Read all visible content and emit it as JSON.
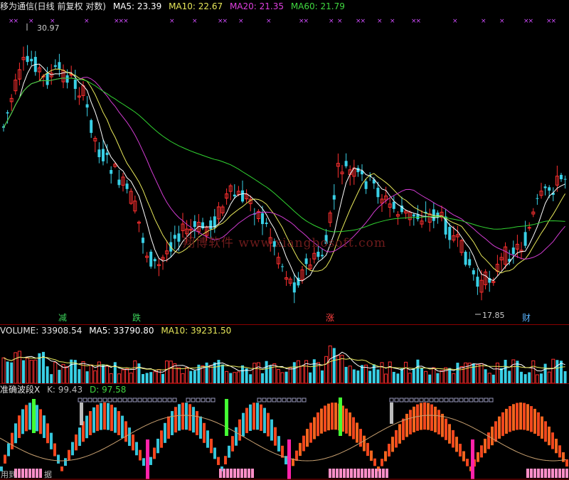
{
  "main": {
    "title": "移为通信(日线 前复权 对数)",
    "ma5": "MA5: 23.39",
    "ma10": "MA10: 22.67",
    "ma20": "MA20: 21.35",
    "ma60": "MA60: 21.79",
    "high_label": "30.97",
    "low_label": "17.85",
    "watermark": "翔博软件 www.xiangbosoft.com",
    "signal_tags": [
      {
        "text": "减",
        "color": "#3cd25a"
      },
      {
        "text": "跌",
        "color": "#3cd25a"
      },
      {
        "text": "涨",
        "color": "#ff4040"
      },
      {
        "text": "财",
        "color": "#5ab4ff"
      }
    ],
    "marker_glyphs": [
      "××",
      "×",
      "×",
      "×",
      "×××",
      "×",
      "×",
      "××",
      "×",
      "×",
      "××",
      "×",
      "×",
      "××",
      "×",
      "×",
      "××",
      "×",
      "×",
      "×",
      "××",
      "××"
    ]
  },
  "volume": {
    "label": "VOLUME: 33908.54",
    "ma5": "MA5: 33790.80",
    "ma10": "MA10: 39231.50"
  },
  "indicator": {
    "name": "准确波段X",
    "k": "K: 99.43",
    "d": "D: 97.58",
    "bottom_left_note": "用到",
    "bottom_note_2": "据"
  },
  "colors": {
    "up": "#ff3030",
    "down": "#39d0e6",
    "ma5": "#ffffff",
    "ma10": "#e8e85a",
    "ma20": "#d23cd2",
    "ma60": "#31d331",
    "divider": "#8b0000"
  }
}
